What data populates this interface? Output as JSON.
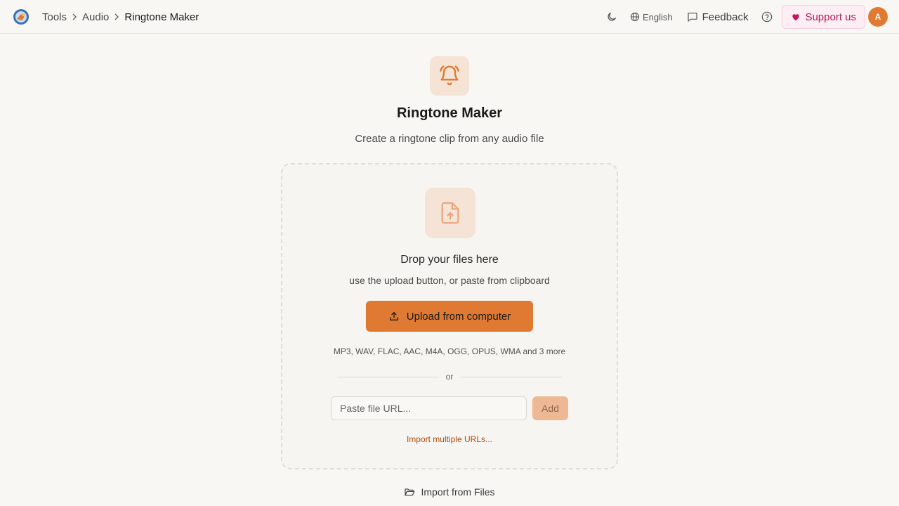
{
  "header": {
    "breadcrumbs": [
      "Tools",
      "Audio",
      "Ringtone Maker"
    ],
    "language": "English",
    "feedback_label": "Feedback",
    "support_label": "Support us",
    "avatar_initial": "A"
  },
  "tool": {
    "icon": "bell-ring-icon",
    "title": "Ringtone Maker",
    "subtitle": "Create a ringtone clip from any audio file"
  },
  "dropzone": {
    "icon": "file-upload-icon",
    "title": "Drop your files here",
    "subtitle": "use the upload button, or paste from clipboard",
    "upload_label": "Upload from computer",
    "formats": "MP3, WAV, FLAC, AAC, M4A, OGG, OPUS, WMA and 3 more",
    "or_label": "or",
    "url_placeholder": "Paste file URL...",
    "add_label": "Add",
    "import_multiple_label": "Import multiple URLs..."
  },
  "footer": {
    "import_files_label": "Import from Files"
  },
  "colors": {
    "accent": "#e07a32",
    "support": "#b01a5a",
    "link": "#b04d0a"
  }
}
